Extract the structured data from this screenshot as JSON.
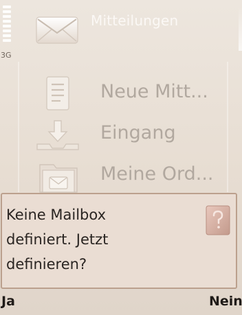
{
  "status": {
    "network": "3G",
    "signal_icon": "signal-strength-icon",
    "battery_icon": "battery-level-icon"
  },
  "header": {
    "title": "Mitteilungen",
    "icon": "envelope-icon"
  },
  "menu": {
    "items": [
      {
        "label": "Neue Mitt...",
        "icon": "new-message-icon"
      },
      {
        "label": "Eingang",
        "icon": "inbox-icon"
      },
      {
        "label": "Meine Ord...",
        "icon": "my-folders-icon"
      }
    ]
  },
  "dialog": {
    "message": "Keine Mailbox\ndefiniert. Jetzt\ndefinieren?",
    "icon": "question-icon"
  },
  "softkeys": {
    "left": "Ja",
    "right": "Nein"
  },
  "colors": {
    "background": "#e8ded4",
    "dialog_background": "#eaddd3",
    "dialog_border": "#bba08d",
    "text_dark": "#2a2522",
    "text_faded": "#b1a89f"
  }
}
